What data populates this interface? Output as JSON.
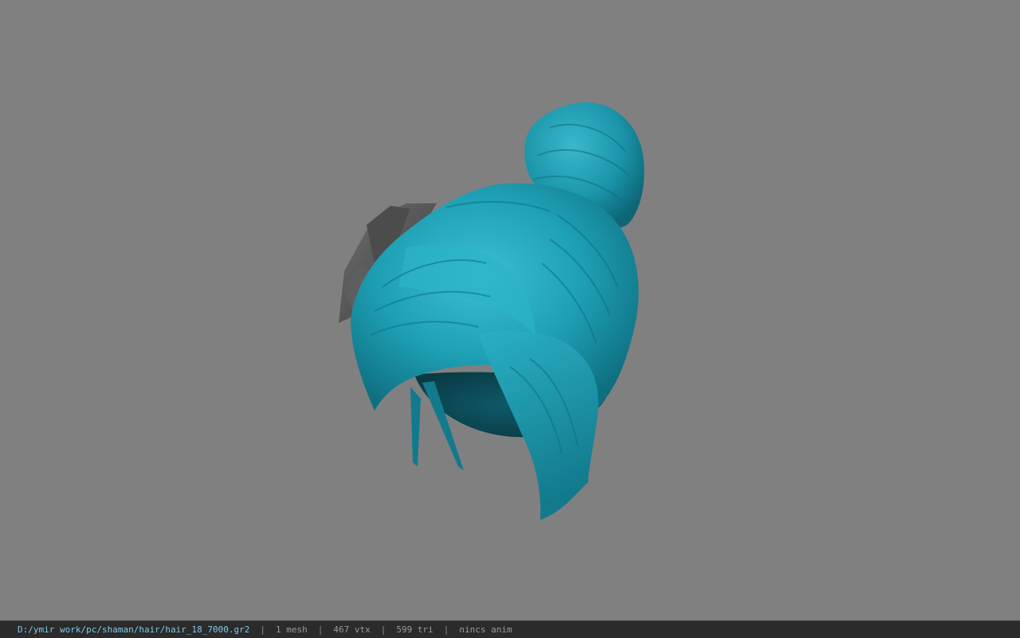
{
  "viewport": {
    "model_name": "hair model render",
    "background": "#808080",
    "hair_color": "#1e9fb4",
    "ornament_color": "#5a5a5a"
  },
  "statusbar": {
    "file_path": "D:/ymir work/pc/shaman/hair/hair_18_7000.gr2",
    "separator": "|",
    "mesh_count": "1 mesh",
    "vertex_count": "467 vtx",
    "triangle_count": "599 tri",
    "anim_status": "nincs anim"
  }
}
